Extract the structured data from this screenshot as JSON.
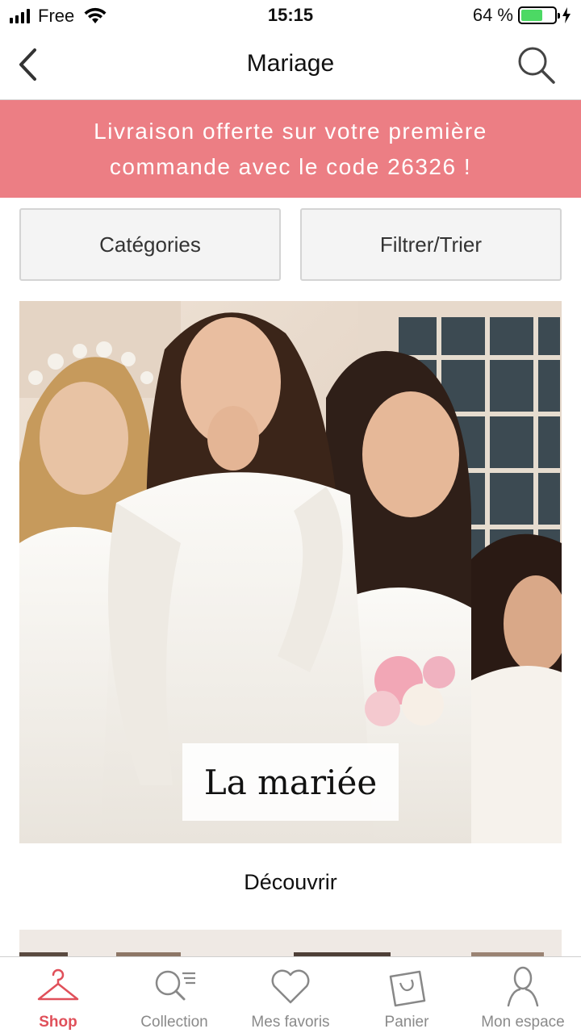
{
  "status_bar": {
    "carrier": "Free",
    "time": "15:15",
    "battery_percent": "64 %",
    "battery_level": 0.64
  },
  "nav": {
    "title": "Mariage",
    "back_icon": "chevron-left-icon",
    "search_icon": "search-icon"
  },
  "promo": {
    "text": "Livraison offerte sur votre première commande avec le code 26326 !",
    "background_color": "#ec7e84"
  },
  "buttons": {
    "categories": "Catégories",
    "filter_sort": "Filtrer/Trier"
  },
  "hero": {
    "label": "La mariée",
    "cta": "Découvrir"
  },
  "tab_bar": {
    "accent_color": "#e0505a",
    "items": [
      {
        "label": "Shop",
        "icon": "hanger-icon",
        "active": true
      },
      {
        "label": "Collection",
        "icon": "collection-search-icon",
        "active": false
      },
      {
        "label": "Mes favoris",
        "icon": "heart-icon",
        "active": false
      },
      {
        "label": "Panier",
        "icon": "shopping-bag-icon",
        "active": false
      },
      {
        "label": "Mon espace",
        "icon": "user-icon",
        "active": false
      }
    ]
  }
}
